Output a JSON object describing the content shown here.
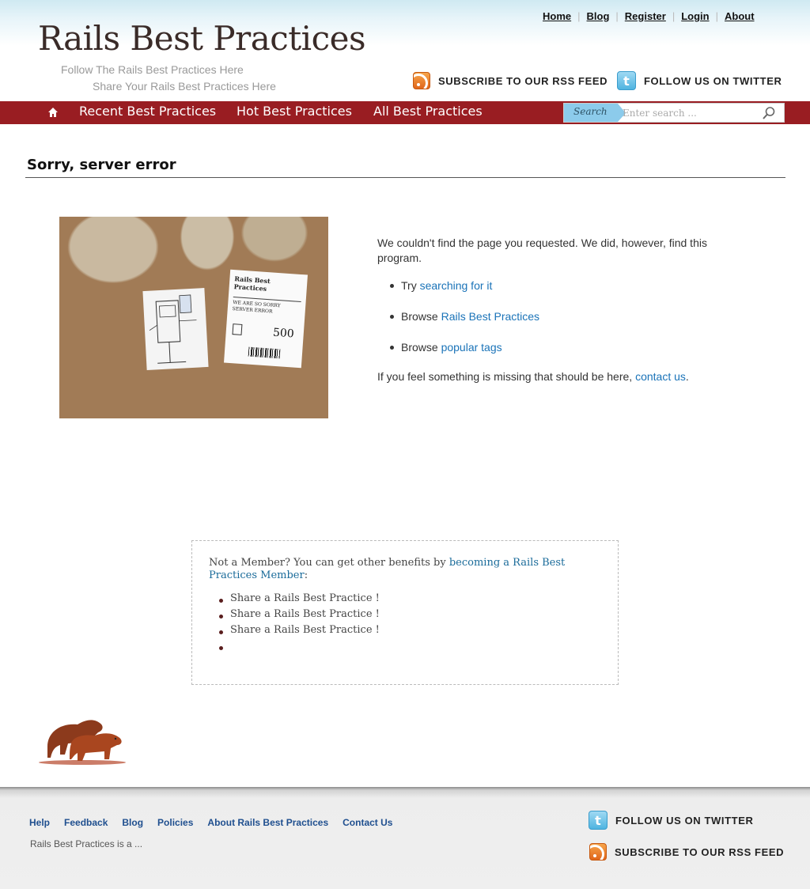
{
  "header": {
    "logo": "Rails Best Practices",
    "tagline_1": "Follow The Rails Best Practices Here",
    "tagline_2": "Share Your Rails Best Practices Here",
    "top_nav": [
      "Home",
      "Blog",
      "Register",
      "Login",
      "About"
    ],
    "rss_label": "SUBSCRIBE TO OUR RSS FEED",
    "twitter_label": "FOLLOW US ON TWITTER"
  },
  "menu": {
    "items": [
      "Recent Best Practices",
      "Hot Best Practices",
      "All Best Practices"
    ],
    "search_tag": "Search",
    "search_placeholder": "Enter search ..."
  },
  "content": {
    "title": "Sorry, server error",
    "image": {
      "sign_title": "Rails Best Practices",
      "sign_subtitle_1": "WE ARE SO SORRY",
      "sign_subtitle_2": "SERVER ERROR",
      "sign_code": "500"
    },
    "intro": "We couldn't find the page you requested. We did, however, find this program.",
    "bullets": [
      {
        "prefix": "Try ",
        "link": "searching for it"
      },
      {
        "prefix": "Browse ",
        "link": "Rails Best Practices"
      },
      {
        "prefix": "Browse ",
        "link": "popular tags"
      }
    ],
    "outro_text": "If you feel something is missing that should be here, ",
    "outro_link": "contact us",
    "outro_end": "."
  },
  "member_box": {
    "text": "Not a Member? You can get other benefits by ",
    "link": "becoming a Rails Best Practices Member",
    "text_end": ":",
    "items": [
      "Share a Rails Best Practice !",
      "Share a Rails Best Practice !",
      "Share a Rails Best Practice !",
      ""
    ]
  },
  "footer": {
    "links": [
      "Help",
      "Feedback",
      "Blog",
      "Policies",
      "About Rails Best Practices",
      "Contact Us"
    ],
    "description": "Rails Best Practices is a ...",
    "twitter_label": "FOLLOW US ON TWITTER",
    "rss_label": "SUBSCRIBE TO OUR RSS FEED"
  },
  "colors": {
    "menu_bar": "#991d22",
    "link": "#1a73b8",
    "search_tag": "#8ccbeb"
  }
}
